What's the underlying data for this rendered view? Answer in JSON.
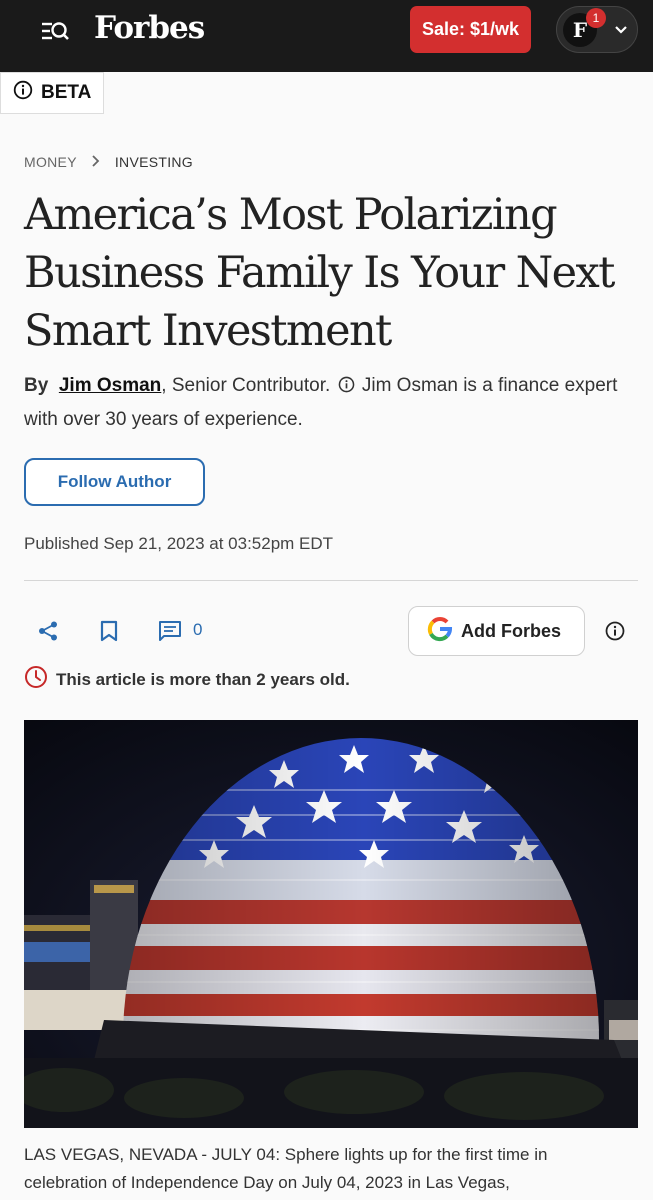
{
  "header": {
    "logo": "Forbes",
    "sale_label": "Sale: $1/wk",
    "avatar_letter": "F",
    "notification_count": "1"
  },
  "beta_label": "BETA",
  "breadcrumb": {
    "section": "MONEY",
    "subsection": "INVESTING"
  },
  "article": {
    "headline": "America’s Most Polarizing Business Family Is Your Next Smart Investment",
    "byline_prefix": "By",
    "author": "Jim Osman",
    "author_role": ", Senior Contributor.",
    "author_bio": "Jim Osman is a finance expert with over 30 years of experience.",
    "follow_label": "Follow Author",
    "published": "Published Sep 21, 2023 at 03:52pm EDT",
    "comment_count": "0",
    "add_forbes_label": "Add Forbes",
    "age_notice": "This article is more than 2 years old.",
    "caption": "LAS VEGAS, NEVADA - JULY 04: Sphere lights up for the first time in celebration of Independence Day on July 04, 2023 in Las Vegas,"
  },
  "icons": [
    "search-menu-icon",
    "chevron-down-icon",
    "info-icon",
    "chevron-right-icon",
    "share-icon",
    "bookmark-icon",
    "comment-icon",
    "google-icon",
    "clock-icon"
  ],
  "colors": {
    "topbar": "#1a1a1a",
    "sale": "#d32f2f",
    "link_blue": "#2b6cb0",
    "warning_red": "#c62828"
  }
}
